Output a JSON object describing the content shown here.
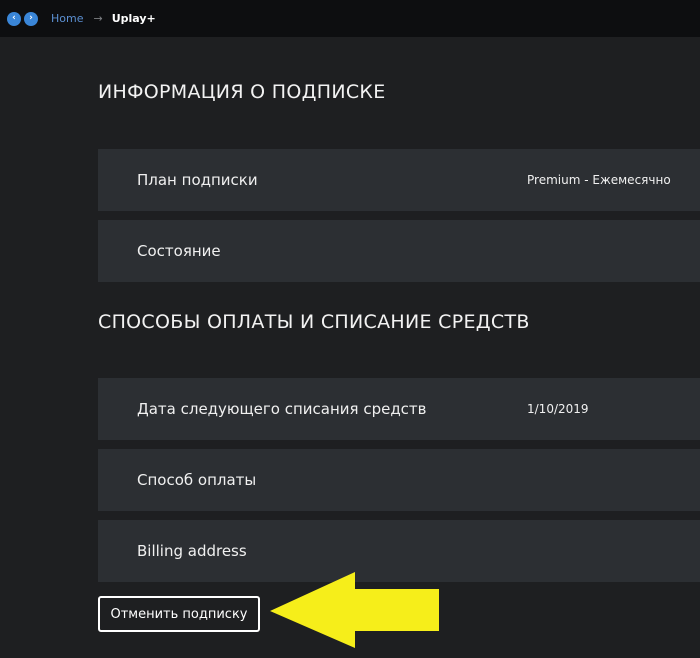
{
  "breadcrumb": {
    "back_glyph": "‹",
    "forward_glyph": "›",
    "home": "Home",
    "separator": "→",
    "current": "Uplay+"
  },
  "subscription": {
    "title": "ИНФОРМАЦИЯ О ПОДПИСКЕ",
    "rows": [
      {
        "label": "План подписки",
        "value": "Premium - Ежемесячно"
      },
      {
        "label": "Состояние",
        "value": ""
      }
    ]
  },
  "payment": {
    "title": "СПОСОБЫ ОПЛАТЫ И СПИСАНИЕ СРЕДСТВ",
    "rows": [
      {
        "label": "Дата следующего списания средств",
        "value": "1/10/2019"
      },
      {
        "label": "Способ оплаты",
        "value": ""
      },
      {
        "label": "Billing address",
        "value": ""
      }
    ]
  },
  "cancel_button": {
    "label": "Отменить подписку"
  },
  "colors": {
    "background": "#1e1f21",
    "topbar": "#0d0e10",
    "row": "#2c2f33",
    "nav_accent": "#3a86d8",
    "arrow": "#f6ee1a"
  },
  "icons": {
    "back": "back-nav-icon",
    "forward": "forward-nav-icon",
    "annotation": "yellow-pointer-arrow"
  }
}
